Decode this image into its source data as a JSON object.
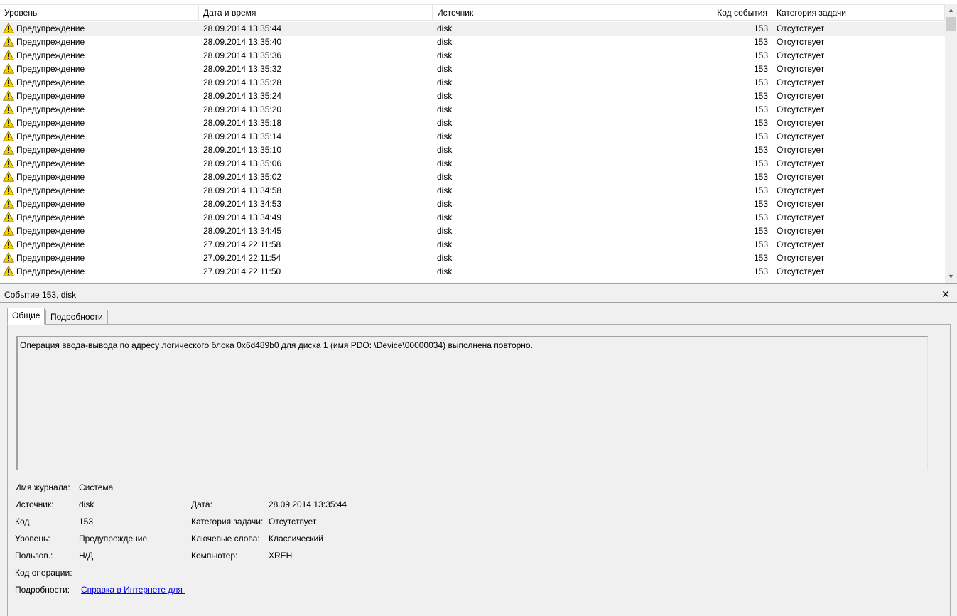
{
  "columns": {
    "level": "Уровень",
    "date": "Дата и время",
    "source": "Источник",
    "code": "Код события",
    "category": "Категория задачи"
  },
  "rows": [
    {
      "level": "Предупреждение",
      "date": "28.09.2014 13:35:44",
      "source": "disk",
      "code": "153",
      "category": "Отсутствует"
    },
    {
      "level": "Предупреждение",
      "date": "28.09.2014 13:35:40",
      "source": "disk",
      "code": "153",
      "category": "Отсутствует"
    },
    {
      "level": "Предупреждение",
      "date": "28.09.2014 13:35:36",
      "source": "disk",
      "code": "153",
      "category": "Отсутствует"
    },
    {
      "level": "Предупреждение",
      "date": "28.09.2014 13:35:32",
      "source": "disk",
      "code": "153",
      "category": "Отсутствует"
    },
    {
      "level": "Предупреждение",
      "date": "28.09.2014 13:35:28",
      "source": "disk",
      "code": "153",
      "category": "Отсутствует"
    },
    {
      "level": "Предупреждение",
      "date": "28.09.2014 13:35:24",
      "source": "disk",
      "code": "153",
      "category": "Отсутствует"
    },
    {
      "level": "Предупреждение",
      "date": "28.09.2014 13:35:20",
      "source": "disk",
      "code": "153",
      "category": "Отсутствует"
    },
    {
      "level": "Предупреждение",
      "date": "28.09.2014 13:35:18",
      "source": "disk",
      "code": "153",
      "category": "Отсутствует"
    },
    {
      "level": "Предупреждение",
      "date": "28.09.2014 13:35:14",
      "source": "disk",
      "code": "153",
      "category": "Отсутствует"
    },
    {
      "level": "Предупреждение",
      "date": "28.09.2014 13:35:10",
      "source": "disk",
      "code": "153",
      "category": "Отсутствует"
    },
    {
      "level": "Предупреждение",
      "date": "28.09.2014 13:35:06",
      "source": "disk",
      "code": "153",
      "category": "Отсутствует"
    },
    {
      "level": "Предупреждение",
      "date": "28.09.2014 13:35:02",
      "source": "disk",
      "code": "153",
      "category": "Отсутствует"
    },
    {
      "level": "Предупреждение",
      "date": "28.09.2014 13:34:58",
      "source": "disk",
      "code": "153",
      "category": "Отсутствует"
    },
    {
      "level": "Предупреждение",
      "date": "28.09.2014 13:34:53",
      "source": "disk",
      "code": "153",
      "category": "Отсутствует"
    },
    {
      "level": "Предупреждение",
      "date": "28.09.2014 13:34:49",
      "source": "disk",
      "code": "153",
      "category": "Отсутствует"
    },
    {
      "level": "Предупреждение",
      "date": "28.09.2014 13:34:45",
      "source": "disk",
      "code": "153",
      "category": "Отсутствует"
    },
    {
      "level": "Предупреждение",
      "date": "27.09.2014 22:11:58",
      "source": "disk",
      "code": "153",
      "category": "Отсутствует"
    },
    {
      "level": "Предупреждение",
      "date": "27.09.2014 22:11:54",
      "source": "disk",
      "code": "153",
      "category": "Отсутствует"
    },
    {
      "level": "Предупреждение",
      "date": "27.09.2014 22:11:50",
      "source": "disk",
      "code": "153",
      "category": "Отсутствует"
    }
  ],
  "selected_row": 0,
  "row_icon": "warning-icon",
  "colors": {
    "warning_fill": "#f5d300",
    "warning_stroke": "#8a6d00",
    "selected_row_bg": "#f0f0f0",
    "link": "#0000ee"
  },
  "detail": {
    "title": "Событие 153, disk",
    "close_icon": "close-icon",
    "tabs": [
      "Общие",
      "Подробности"
    ],
    "active_tab": 0,
    "description": "Операция ввода-вывода по адресу логического блока 0x6d489b0 для диска 1 (имя PDO: \\Device\\00000034) выполнена повторно.",
    "log_name_label": "Имя журнала:",
    "log_name_value": "Система",
    "source_label": "Источник:",
    "source_value": "disk",
    "date_label": "Дата:",
    "date_value": "28.09.2014 13:35:44",
    "code_label": "Код",
    "code_value": "153",
    "category_label": "Категория задачи:",
    "category_value": "Отсутствует",
    "level_label": "Уровень:",
    "level_value": "Предупреждение",
    "keywords_label": "Ключевые слова:",
    "keywords_value": "Классический",
    "user_label": "Пользов.:",
    "user_value": "Н/Д",
    "computer_label": "Компьютер:",
    "computer_value": "XREH",
    "opcode_label": "Код операции:",
    "details_label": "Подробности:",
    "details_link": "Справка в Интернете для "
  }
}
